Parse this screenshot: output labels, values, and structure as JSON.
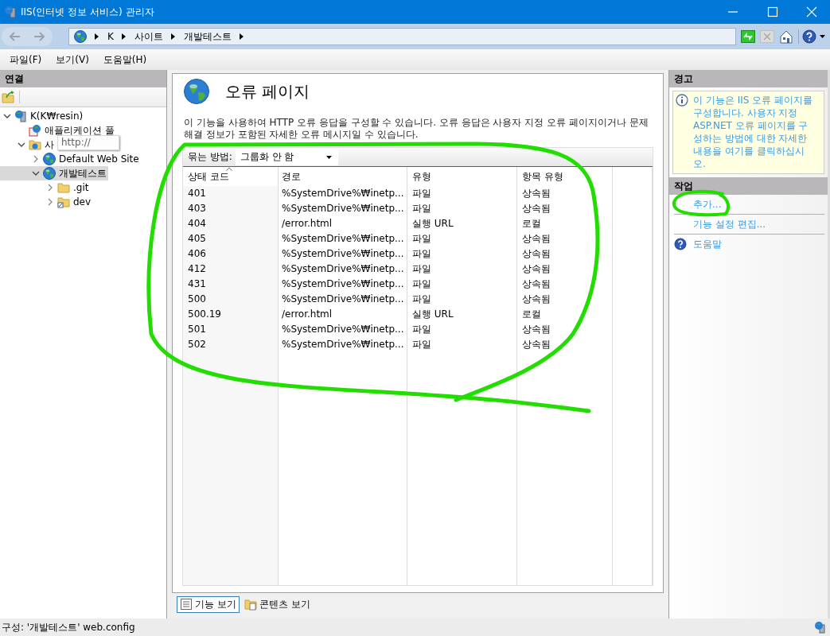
{
  "window": {
    "title": "IIS(인터넷 정보 서비스) 관리자"
  },
  "breadcrumb": [
    "K",
    "사이트",
    "개발테스트"
  ],
  "menu": [
    "파일(F)",
    "보기(V)",
    "도움말(H)"
  ],
  "connections": {
    "title": "연결",
    "tooltip": "http://",
    "tree": [
      {
        "label": "K(K₩resin)",
        "kind": "server",
        "expanded": true,
        "selected": false,
        "children": [
          {
            "label": "애플리케이션 풀",
            "kind": "pool",
            "selected": false
          },
          {
            "label": "사",
            "kind": "sites",
            "expanded": true,
            "selected": false,
            "children": [
              {
                "label": "Default Web Site",
                "kind": "site",
                "expanded": false,
                "selected": false
              },
              {
                "label": "개발테스트",
                "kind": "site",
                "expanded": true,
                "selected": true,
                "children": [
                  {
                    "label": ".git",
                    "kind": "folder",
                    "expanded": false,
                    "selected": false
                  },
                  {
                    "label": "dev",
                    "kind": "vdir",
                    "expanded": false,
                    "selected": false
                  }
                ]
              }
            ]
          }
        ]
      }
    ]
  },
  "feature": {
    "title": "오류 페이지",
    "description": "이 기능을 사용하여 HTTP 오류 응답을 구성할 수 있습니다. 오류 응답은 사용자 지정 오류 페이지이거나 문제 해결 정보가 포함된 자세한 오류 메시지일 수 있습니다.",
    "group_by": {
      "label": "묶는 방법:",
      "value": "그룹화 안 함"
    },
    "table": {
      "columns": [
        {
          "label": "상태 코드",
          "sorted": true
        },
        {
          "label": "경로",
          "sorted": false
        },
        {
          "label": "유형",
          "sorted": false
        },
        {
          "label": "항목 유형",
          "sorted": false
        }
      ],
      "rows": [
        [
          "401",
          "%SystemDrive%₩inetp...",
          "파일",
          "상속됨"
        ],
        [
          "403",
          "%SystemDrive%₩inetp...",
          "파일",
          "상속됨"
        ],
        [
          "404",
          "/error.html",
          "실행 URL",
          "로컬"
        ],
        [
          "405",
          "%SystemDrive%₩inetp...",
          "파일",
          "상속됨"
        ],
        [
          "406",
          "%SystemDrive%₩inetp...",
          "파일",
          "상속됨"
        ],
        [
          "412",
          "%SystemDrive%₩inetp...",
          "파일",
          "상속됨"
        ],
        [
          "431",
          "%SystemDrive%₩inetp...",
          "파일",
          "상속됨"
        ],
        [
          "500",
          "%SystemDrive%₩inetp...",
          "파일",
          "상속됨"
        ],
        [
          "500.19",
          "/error.html",
          "실행 URL",
          "로컬"
        ],
        [
          "501",
          "%SystemDrive%₩inetp...",
          "파일",
          "상속됨"
        ],
        [
          "502",
          "%SystemDrive%₩inetp...",
          "파일",
          "상속됨"
        ]
      ]
    }
  },
  "views": [
    {
      "label": "기능 보기",
      "selected": true
    },
    {
      "label": "콘텐츠 보기",
      "selected": false
    }
  ],
  "alerts": {
    "title": "경고",
    "message": "이 기능은 IIS 오류 페이지를 구성합니다. 사용자 지정 ASP.NET 오류 페이지를 구성하는 방법에 대한 자세한 내용을 여기를 클릭하십시오."
  },
  "actions": {
    "title": "작업",
    "items": [
      {
        "label": "추가...",
        "kind": "link"
      },
      {
        "label": "기능 설정 편집...",
        "kind": "link"
      },
      {
        "label": "도움말",
        "kind": "help"
      }
    ]
  },
  "status_bar": "구성: '개발테스트' web.config",
  "scribbles": {
    "around_table": true,
    "around_add": true
  }
}
